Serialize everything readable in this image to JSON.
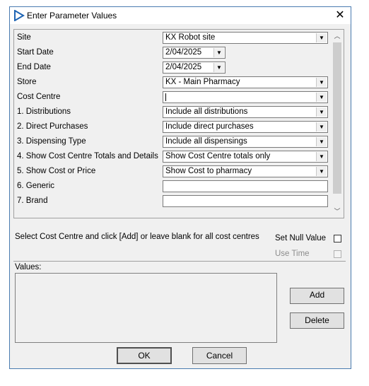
{
  "window": {
    "title": "Enter Parameter Values",
    "close_symbol": "✕"
  },
  "params": [
    {
      "label": "Site",
      "type": "combo",
      "value": "KX Robot site"
    },
    {
      "label": "Start Date",
      "type": "date",
      "value": "2/04/2025"
    },
    {
      "label": "End Date",
      "type": "date",
      "value": "2/04/2025"
    },
    {
      "label": "Store",
      "type": "combo",
      "value": "KX - Main Pharmacy"
    },
    {
      "label": "Cost Centre",
      "type": "combo",
      "value": ""
    },
    {
      "label": "1. Distributions",
      "type": "combo",
      "value": "Include all distributions"
    },
    {
      "label": "2. Direct Purchases",
      "type": "combo",
      "value": "Include direct purchases"
    },
    {
      "label": "3. Dispensing Type",
      "type": "combo",
      "value": "Include all dispensings"
    },
    {
      "label": "4. Show Cost Centre Totals and Details",
      "type": "combo",
      "value": "Show Cost Centre totals only"
    },
    {
      "label": "5. Show Cost or Price",
      "type": "combo",
      "value": "Show Cost to pharmacy"
    },
    {
      "label": "6. Generic",
      "type": "text",
      "value": ""
    },
    {
      "label": "7. Brand",
      "type": "text",
      "value": ""
    }
  ],
  "hint": "Select Cost Centre and click [Add] or leave blank for all cost centres",
  "set_null_label": "Set Null Value",
  "use_time_label": "Use Time",
  "values_label": "Values:",
  "buttons": {
    "add": "Add",
    "delete": "Delete",
    "ok": "OK",
    "cancel": "Cancel"
  },
  "colors": {
    "accent": "#0078d7",
    "frame": "#4a7bb0"
  }
}
